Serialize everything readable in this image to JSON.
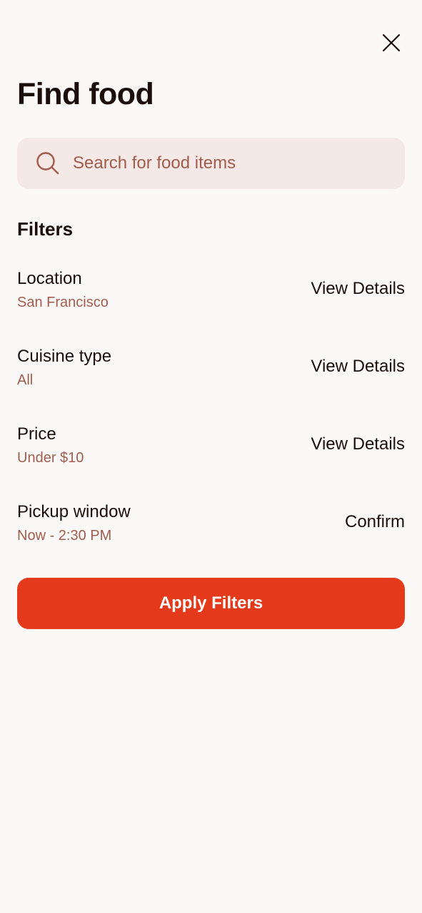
{
  "header": {
    "title": "Find food",
    "close_icon": "close-icon"
  },
  "search": {
    "placeholder": "Search for food items",
    "value": "",
    "icon": "search-icon"
  },
  "filters": {
    "heading": "Filters",
    "items": [
      {
        "label": "Location",
        "value": "San Francisco",
        "action": "View Details"
      },
      {
        "label": "Cuisine type",
        "value": "All",
        "action": "View Details"
      },
      {
        "label": "Price",
        "value": "Under $10",
        "action": "View Details"
      },
      {
        "label": "Pickup window",
        "value": "Now - 2:30 PM",
        "action": "Confirm"
      }
    ]
  },
  "apply_button": {
    "label": "Apply Filters"
  },
  "colors": {
    "background": "#FBF9F8",
    "accent": "#E43A1B",
    "search_background": "#F4E9E6",
    "secondary_text": "#A25C4C",
    "primary_text": "#1B0E0B"
  }
}
